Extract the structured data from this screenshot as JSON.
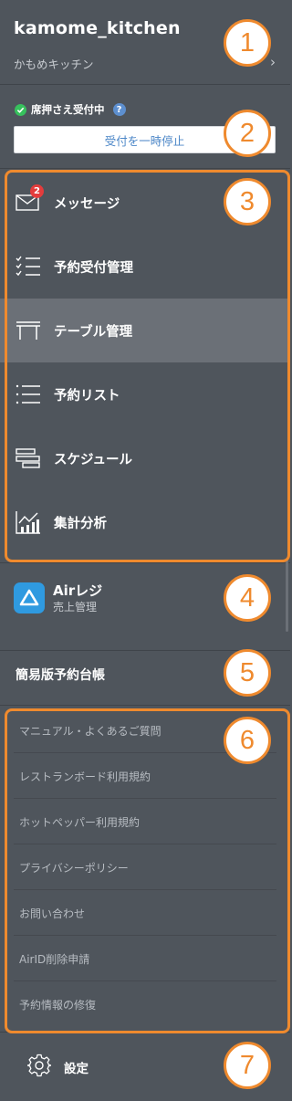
{
  "store": {
    "name": "kamome_kitchen",
    "subtitle": "かもめキッチン",
    "chevron": "›"
  },
  "reservation": {
    "status": "席押さえ受付中",
    "help": "?",
    "pause_button": "受付を一時停止"
  },
  "nav": {
    "items": [
      {
        "label": "メッセージ",
        "icon": "envelope-icon",
        "badge": "2"
      },
      {
        "label": "予約受付管理",
        "icon": "checklist-icon"
      },
      {
        "label": "テーブル管理",
        "icon": "table-icon",
        "active": true
      },
      {
        "label": "予約リスト",
        "icon": "list-icon"
      },
      {
        "label": "スケジュール",
        "icon": "schedule-icon"
      },
      {
        "label": "集計分析",
        "icon": "chart-icon"
      }
    ]
  },
  "air_regi": {
    "name": "Airレジ",
    "subtitle": "売上管理",
    "icon": "air-regi-logo-icon"
  },
  "simple_book": "簡易版予約台帳",
  "links": [
    "マニュアル・よくあるご質問",
    "レストランボード利用規約",
    "ホットペッパー利用規約",
    "プライバシーポリシー",
    "お問い合わせ",
    "AirID削除申請",
    "予約情報の修復"
  ],
  "settings": {
    "label": "設定",
    "icon": "gear-icon"
  },
  "callouts": [
    "1",
    "2",
    "3",
    "4",
    "5",
    "6",
    "7"
  ],
  "colors": {
    "background": "#4f555c",
    "active": "#6b7077",
    "callout": "#ef8a2e",
    "badge": "#e43c3c",
    "link": "#4b86c7",
    "air_regi": "#2f9ae0"
  }
}
